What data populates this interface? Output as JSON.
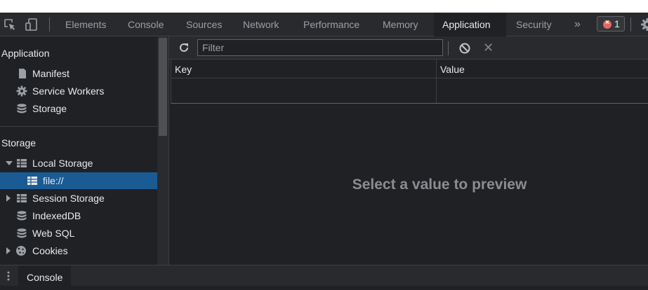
{
  "toolbar": {
    "tabs": [
      {
        "label": "Elements"
      },
      {
        "label": "Console"
      },
      {
        "label": "Sources"
      },
      {
        "label": "Network"
      },
      {
        "label": "Performance"
      },
      {
        "label": "Memory"
      },
      {
        "label": "Application"
      },
      {
        "label": "Security"
      }
    ],
    "overflow": "»",
    "error_count": "1"
  },
  "sidebar": {
    "application_title": "Application",
    "application_items": [
      {
        "label": "Manifest",
        "icon": "file-icon"
      },
      {
        "label": "Service Workers",
        "icon": "gear-icon"
      },
      {
        "label": "Storage",
        "icon": "database-icon"
      }
    ],
    "storage_title": "Storage",
    "storage_items": [
      {
        "label": "Local Storage",
        "icon": "grid-icon",
        "expanded": true
      },
      {
        "label": "file://",
        "icon": "grid-icon",
        "selected": true
      },
      {
        "label": "Session Storage",
        "icon": "grid-icon",
        "expanded": false
      },
      {
        "label": "IndexedDB",
        "icon": "database-icon"
      },
      {
        "label": "Web SQL",
        "icon": "database-icon"
      },
      {
        "label": "Cookies",
        "icon": "cookie-icon",
        "expanded": false
      }
    ]
  },
  "main": {
    "filter": {
      "placeholder": "Filter",
      "value": ""
    },
    "columns": [
      "Key",
      "Value"
    ],
    "preview_text": "Select a value to preview"
  },
  "drawer": {
    "tab_label": "Console"
  },
  "colors": {
    "selected": "#1a5b93",
    "error": "#e46962"
  }
}
